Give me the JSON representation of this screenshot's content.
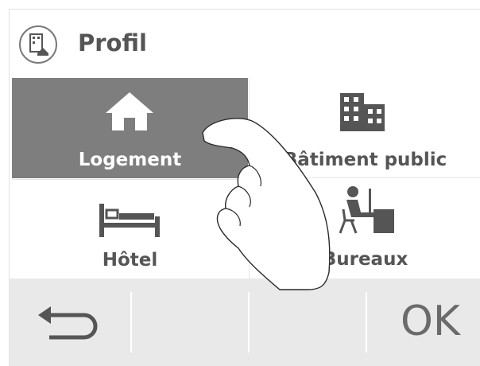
{
  "header": {
    "title": "Profil",
    "icon": "building-profile-icon"
  },
  "tiles": [
    {
      "label": "Logement",
      "icon": "house-icon",
      "selected": true
    },
    {
      "label": "Bâtiment public",
      "icon": "office-building-icon",
      "selected": false
    },
    {
      "label": "Hôtel",
      "icon": "bed-icon",
      "selected": false
    },
    {
      "label": "Bureaux",
      "icon": "desk-worker-icon",
      "selected": false
    }
  ],
  "footer": {
    "back_icon": "back-arrow-icon",
    "ok_label": "OK"
  },
  "colors": {
    "selected_tile": "#7e7e7e",
    "text": "#555555",
    "footer_bg": "#e9e9e9"
  }
}
